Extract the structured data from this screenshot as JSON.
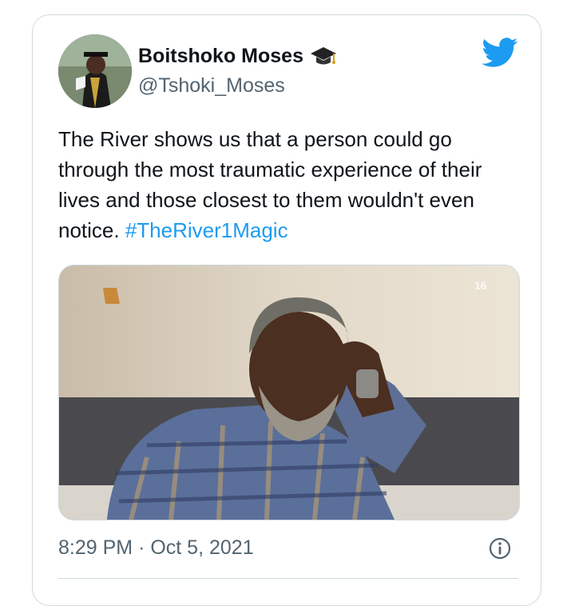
{
  "author": {
    "display_name": "Boitshoko Moses",
    "handle": "@Tshoki_Moses",
    "name_badge_icon": "graduation-cap-icon"
  },
  "tweet": {
    "text": "The River shows us that a person could go through the most traumatic experience of their lives and those closest to them wouldn't even notice. ",
    "hashtag": "#TheRiver1Magic",
    "time": "8:29 PM",
    "separator": "·",
    "date": "Oct 5, 2021"
  },
  "media": {
    "channel_badge": "16"
  },
  "colors": {
    "link": "#1d9bf0",
    "twitter_blue": "#1d9bf0",
    "text_primary": "#0f1419",
    "text_secondary": "#536471"
  }
}
